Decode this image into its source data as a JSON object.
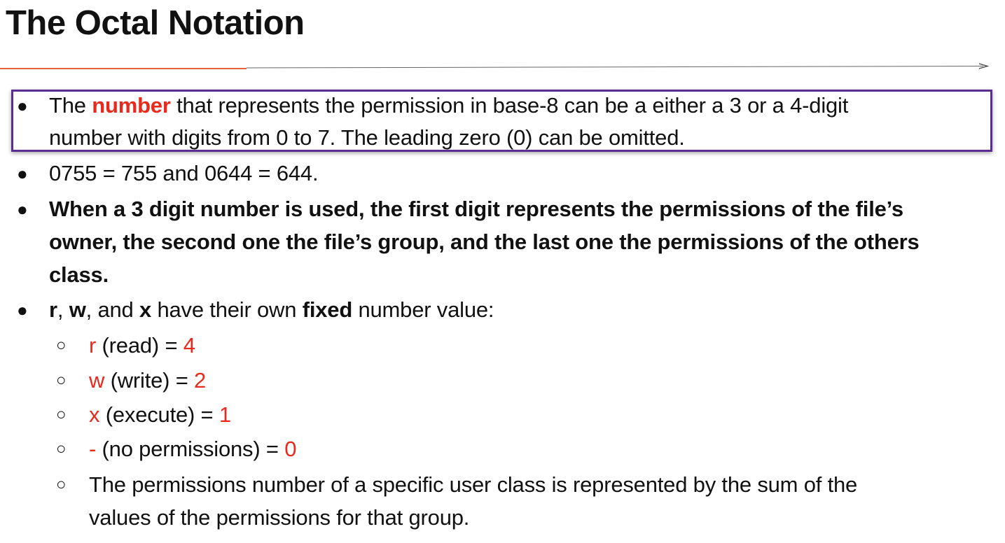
{
  "slide": {
    "title": "The Octal Notation"
  },
  "bullets": {
    "marker": "●",
    "sub_marker": "○",
    "b1": {
      "part1": "The ",
      "emphasis": "number",
      "part2": " that represents the permission in base-8  can be a either a 3 or a 4-digit",
      "line2": "number with digits from 0 to 7.  The leading zero (0) can be omitted."
    },
    "b2": {
      "text": "0755 = 755 and 0644 = 644."
    },
    "b3": {
      "line1": "When a 3 digit number is used, the first digit represents the permissions of the file’s",
      "line2": "owner, the second one the file’s group, and the last one the permissions of the others",
      "line3": "class."
    },
    "b4": {
      "r": "r",
      "sep1": ", ",
      "w": "w",
      "sep2": ", and ",
      "x": "x",
      "mid": " have their own ",
      "fixed": "fixed",
      "end": " number value:"
    },
    "sub": [
      {
        "sym": "r",
        "desc": " (read) = ",
        "val": "4"
      },
      {
        "sym": "w",
        "desc": " (write) = ",
        "val": "2"
      },
      {
        "sym": "x",
        "desc": " (execute) = ",
        "val": "1"
      },
      {
        "sym": "-",
        "desc": " (no permissions) = ",
        "val": "0"
      }
    ],
    "sub5": {
      "line1": "The permissions number of a specific user class is represented by the sum of the",
      "line2": "values of the permissions for that group."
    }
  },
  "colors": {
    "accent_red": "#e8291c",
    "divider_orange": "#e8643a",
    "box_purple": "#5b2d91",
    "text": "#111111"
  }
}
